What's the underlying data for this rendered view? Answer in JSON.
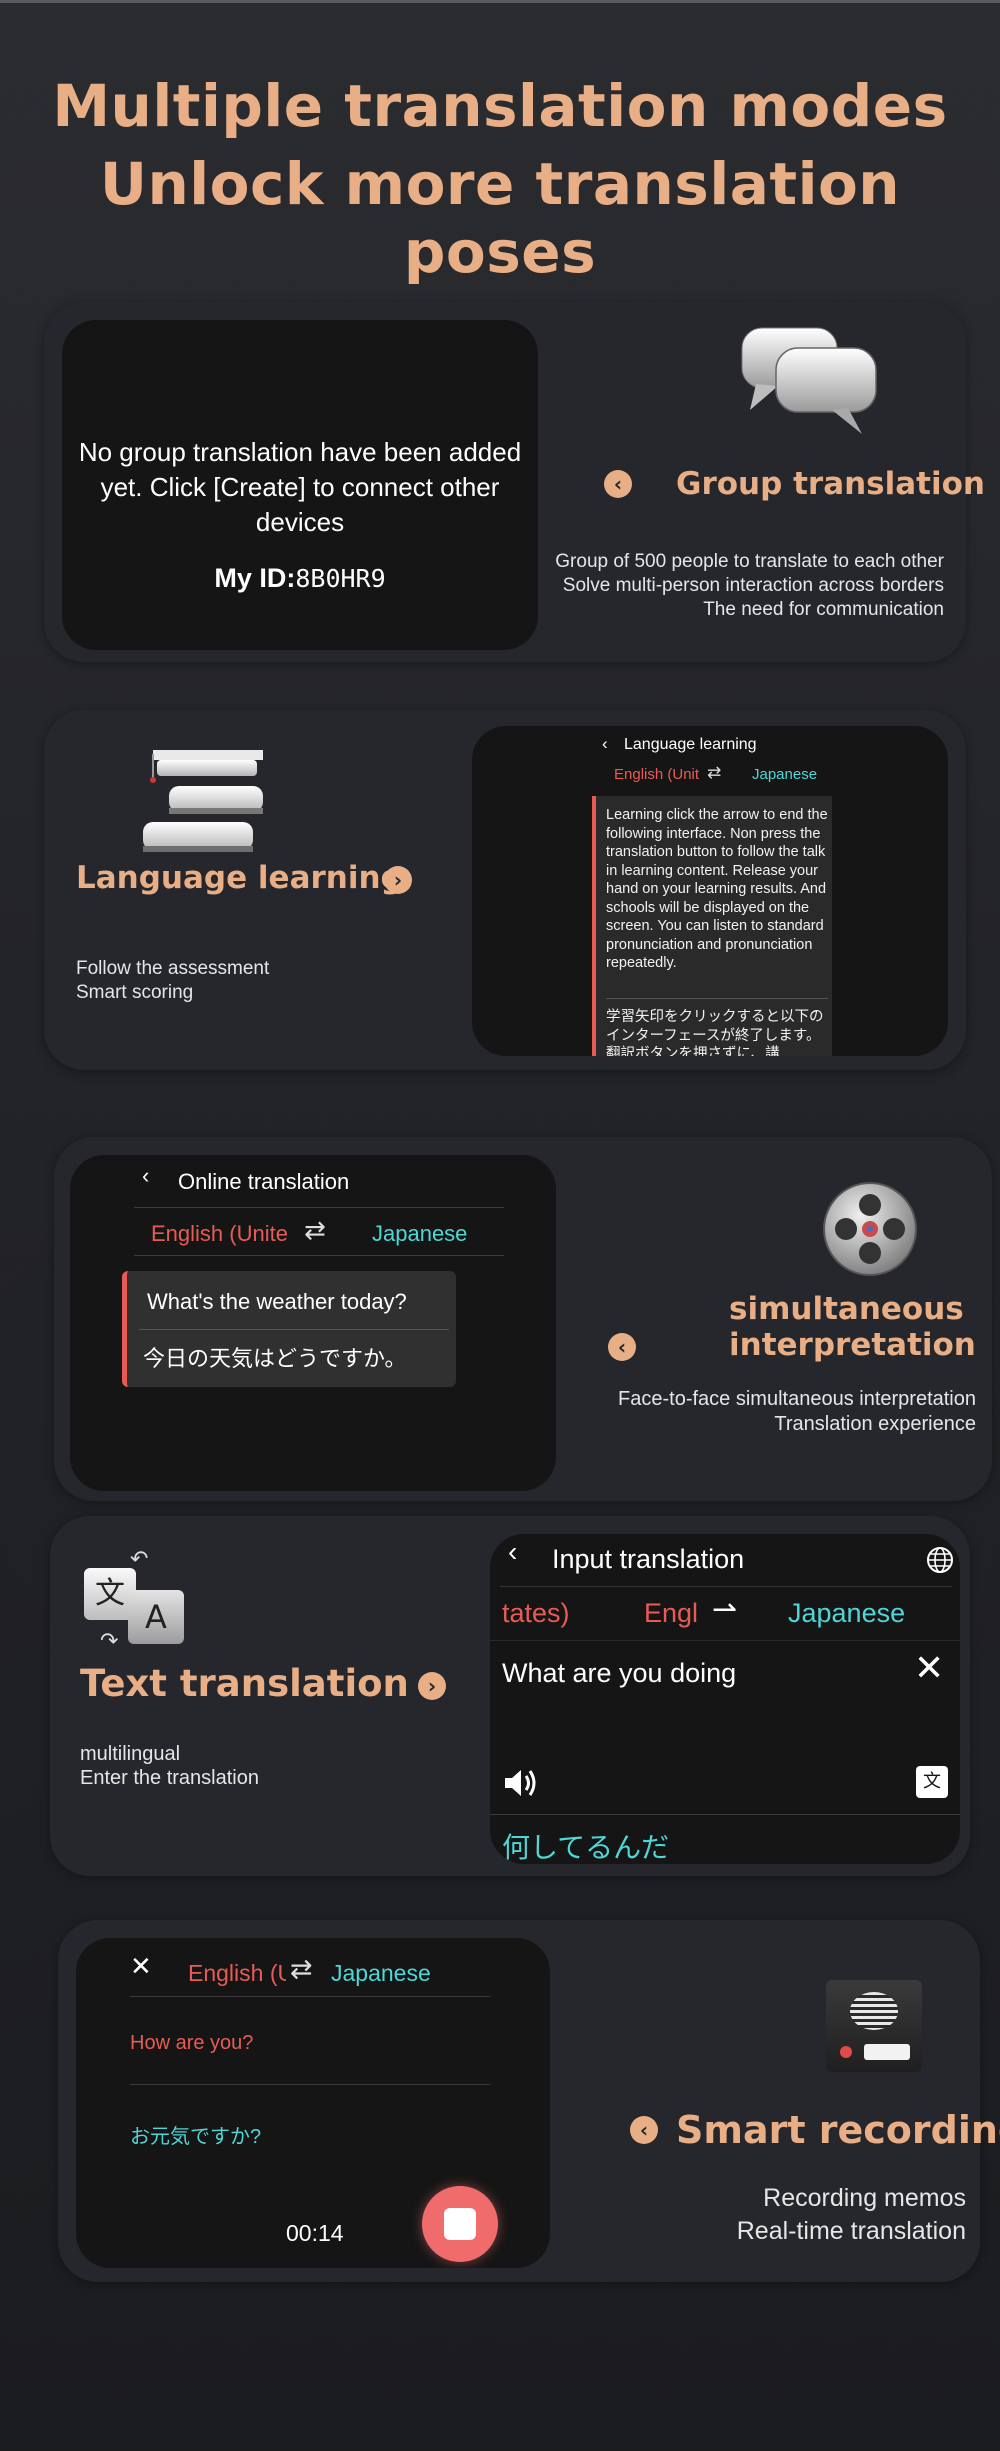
{
  "headline": {
    "line1": "Multiple translation modes",
    "line2": "Unlock more translation poses"
  },
  "group": {
    "title": "Group translation",
    "desc": [
      "Group of 500 people to translate to each other",
      "Solve multi-person interaction across borders",
      "The need for communication"
    ],
    "screen_message": "No group translation have been added yet. Click [Create] to connect other devices",
    "id_label": "My ID:",
    "id_value": "8B0HR9"
  },
  "learning": {
    "title": "Language learning",
    "desc": [
      "Follow the assessment",
      "Smart scoring"
    ],
    "screen_title": "Language learning",
    "lang_from": "English (Unit",
    "lang_to": "Japanese",
    "swap": "⇄",
    "english_text": "Learning click the arrow to end the following interface. Non press the translation button to follow the talk in learning content. Release your hand on your learning results. And schools will be displayed on the screen. You can listen to standard pronunciation and pronunciation repeatedly.",
    "japanese_text": "学習矢印をクリックすると以下のインターフェースが終了します。翻訳ボタンを押さずに、講"
  },
  "simul": {
    "title_line1": "simultaneous",
    "title_line2": "interpretation",
    "desc": [
      "Face-to-face simultaneous interpretation",
      "Translation experience"
    ],
    "screen_title": "Online translation",
    "lang_from": "English (Unite",
    "lang_to": "Japanese",
    "swap": "⇄",
    "bubble_en": "What's the weather today?",
    "bubble_ja": "今日の天気はどうですか。"
  },
  "text": {
    "title": "Text translation",
    "desc": [
      "multilingual",
      "Enter the translation"
    ],
    "icon_glyph_1": "文",
    "icon_glyph_2": "A",
    "screen_title": "Input translation",
    "lang_partial": "tates)",
    "lang_from": "Engl",
    "lang_to": "Japanese",
    "swap": "⇀",
    "input_text": "What are you doing",
    "output_text": "何してるんだ"
  },
  "recording": {
    "title": "Smart recording",
    "desc": [
      "Recording memos",
      "Real-time translation"
    ],
    "lang_from": "English (U",
    "lang_to": "Japanese",
    "swap": "⇄",
    "source_text": "How are you?",
    "target_text": "お元気ですか?",
    "timer": "00:14"
  },
  "colors": {
    "accent": "#e8ae86",
    "red": "#e85b55",
    "cyan": "#4fd6d6"
  }
}
